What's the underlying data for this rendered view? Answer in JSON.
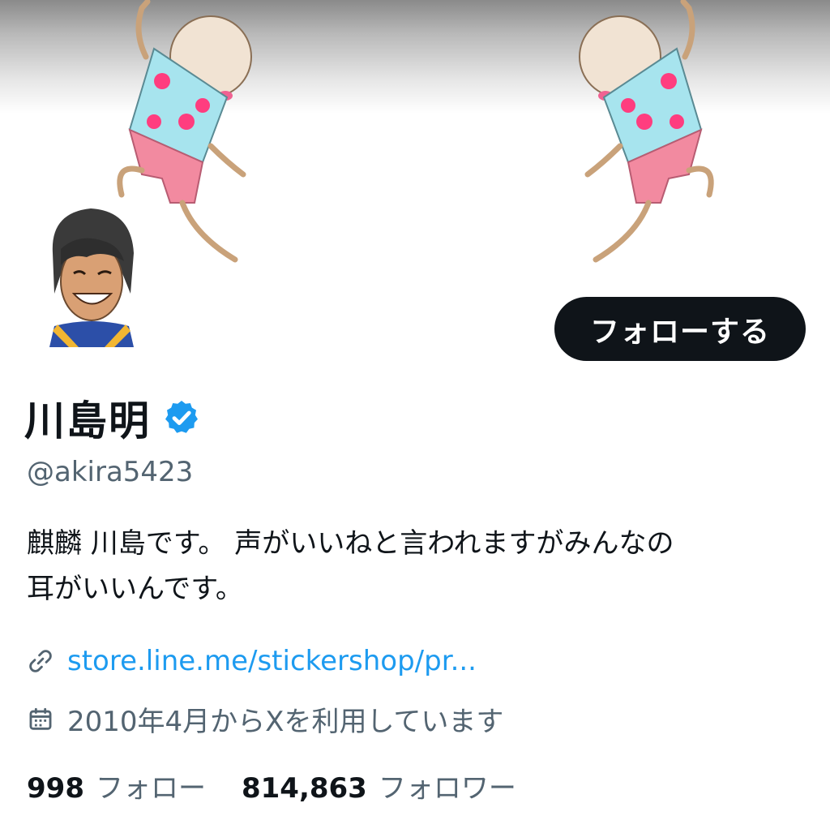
{
  "profile": {
    "name": "川島明",
    "handle": "@akira5423",
    "bio_line1": "麒麟 川島です。 声がいいねと言われますがみんなの",
    "bio_line2": "耳がいいんです。",
    "link": "store.line.me/stickershop/pr...",
    "joined": "2010年4月からXを利用しています",
    "verified": true
  },
  "actions": {
    "follow_label": "フォローする"
  },
  "stats": {
    "following_count": "998",
    "following_label": "フォロー",
    "followers_count": "814,863",
    "followers_label": "フォロワー"
  },
  "icons": {
    "verified": "verified-badge-icon",
    "link": "link-icon",
    "calendar": "calendar-icon"
  },
  "colors": {
    "accent": "#1d9bf0",
    "text": "#0f1419",
    "secondary": "#536471",
    "button_bg": "#0f1419"
  }
}
